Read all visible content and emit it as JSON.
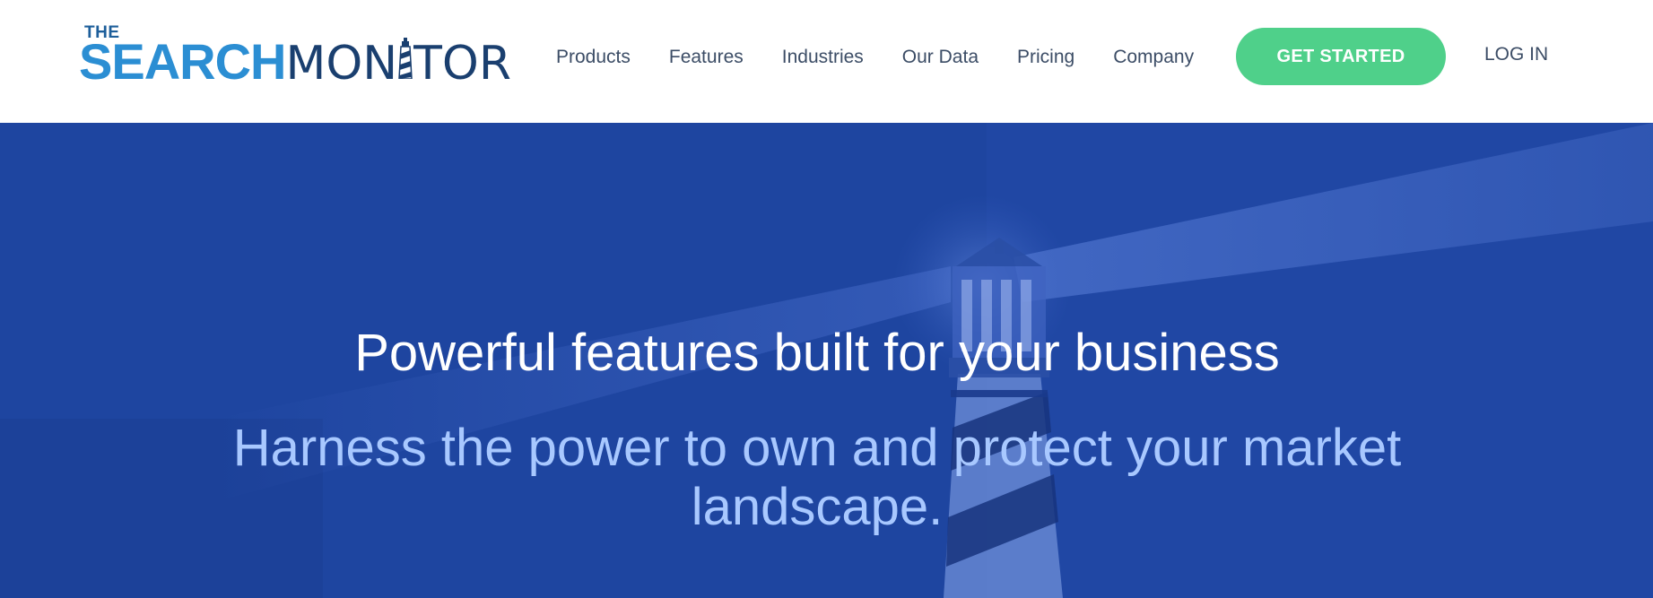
{
  "logo": {
    "the": "THE",
    "search": "SEARCH",
    "monitor_pre": "MON",
    "monitor_post": "TOR",
    "icon": "lighthouse-icon"
  },
  "nav": {
    "items": [
      "Products",
      "Features",
      "Industries",
      "Our Data",
      "Pricing",
      "Company"
    ]
  },
  "cta": {
    "label": "GET STARTED"
  },
  "login": {
    "label": "LOG IN"
  },
  "hero": {
    "title": "Powerful features built for your business",
    "subtitle": "Harness the power to own and protect your market landscape.",
    "image": "lighthouse-background"
  },
  "colors": {
    "cta": "#4fd08a",
    "hero_bg": "#1e45a0",
    "logo_blue": "#2b8ed3",
    "logo_navy": "#1a3f6f",
    "nav_text": "#3c4d66",
    "subtitle": "#a8c8ff"
  }
}
